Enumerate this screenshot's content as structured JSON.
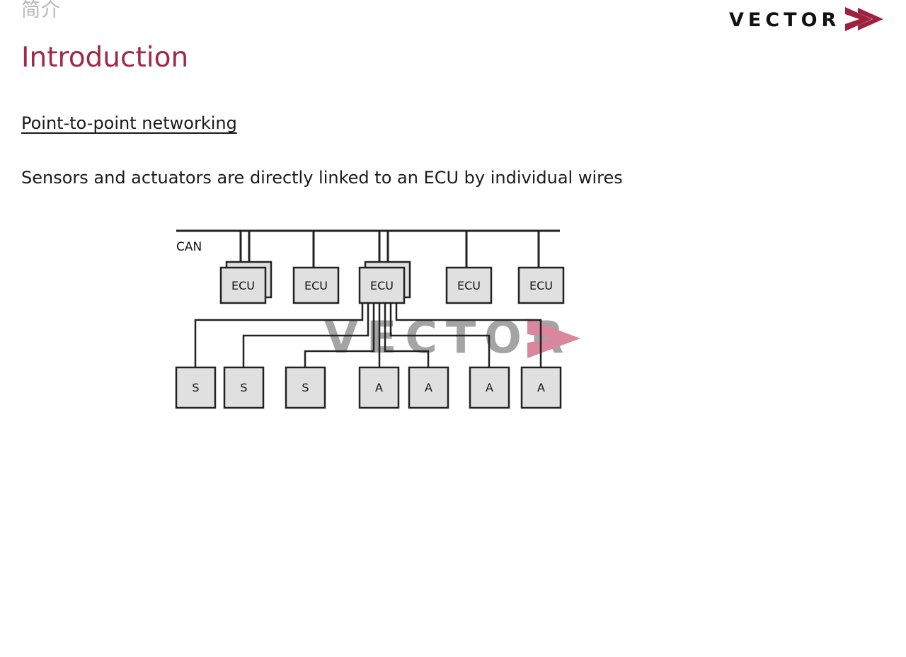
{
  "slide": {
    "tag_cn": "简介",
    "title": "Introduction",
    "subheading": "Point-to-point networking",
    "body_text": "Sensors and actuators are directly linked to an ECU by individual wires"
  },
  "brand": {
    "wordmark": "VECTOR",
    "arrow_icon": "vector-arrow-icon",
    "wordmark_color": "#111111",
    "arrow_color": "#9e2140"
  },
  "watermark": {
    "text": "VECTOR",
    "arrow_icon": "vector-arrow-icon",
    "text_color": "#7d7d7d",
    "arrow_color": "#d4718f"
  },
  "theme": {
    "title_color": "#9e2a4a",
    "text_color": "#1a1a1a",
    "tag_color": "#b8b8b8",
    "box_fill": "#e0e0e0",
    "box_stroke": "#222222",
    "wire_color": "#222222"
  },
  "diagram": {
    "bus_label": "CAN",
    "ecu_nodes": [
      {
        "label": "ECU",
        "stacked": true,
        "bus_links": 2
      },
      {
        "label": "ECU",
        "stacked": false,
        "bus_links": 1
      },
      {
        "label": "ECU",
        "stacked": true,
        "bus_links": 2
      },
      {
        "label": "ECU",
        "stacked": false,
        "bus_links": 1
      },
      {
        "label": "ECU",
        "stacked": false,
        "bus_links": 1
      }
    ],
    "io_nodes": [
      {
        "label": "S",
        "type": "sensor"
      },
      {
        "label": "S",
        "type": "sensor"
      },
      {
        "label": "S",
        "type": "sensor"
      },
      {
        "label": "A",
        "type": "actuator"
      },
      {
        "label": "A",
        "type": "actuator"
      },
      {
        "label": "A",
        "type": "actuator"
      },
      {
        "label": "A",
        "type": "actuator"
      }
    ],
    "individual_wire_count": 7
  }
}
